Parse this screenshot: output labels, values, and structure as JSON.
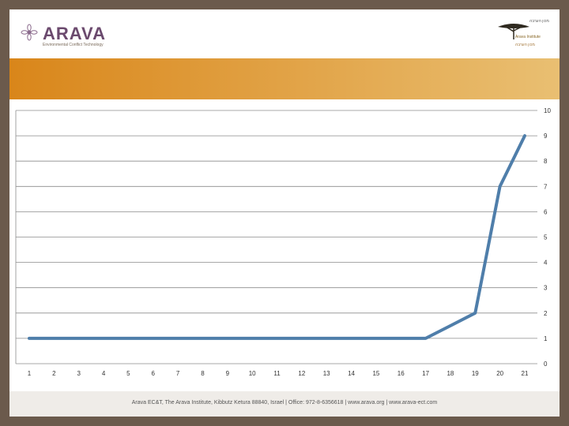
{
  "header": {
    "brand": "ARAVA",
    "tagline": "Environmental Conflict Technology",
    "right_line1": "מכון הערבה",
    "right_line2": "Arava Institute",
    "right_line3": "מכון הערבה"
  },
  "banner": {
    "title": ""
  },
  "footer": {
    "text": "Arava EC&T, The Arava Institute, Kibbutz Ketura 88840, Israel  |  Office: 972-8-6356618  |  www.arava.org  |  www.arava-ect.com"
  },
  "colors": {
    "background": "#6b5a4c",
    "banner_start": "#d9861a",
    "banner_end": "#e9bf72",
    "line": "#4f7eaa",
    "brand": "#6b4a6e"
  },
  "icons": {
    "brand_logo": "flower-icon",
    "institute_logo": "acacia-tree-icon"
  },
  "chart_data": {
    "type": "line",
    "title": "",
    "xlabel": "",
    "ylabel": "",
    "x": [
      1,
      2,
      3,
      4,
      5,
      6,
      7,
      8,
      9,
      10,
      11,
      12,
      13,
      14,
      15,
      16,
      17,
      18,
      19,
      20,
      21
    ],
    "series": [
      {
        "values": [
          1,
          1,
          1,
          1,
          1,
          1,
          1,
          1,
          1,
          1,
          1,
          1,
          1,
          1,
          1,
          1,
          1,
          1.5,
          2,
          7,
          9
        ]
      }
    ],
    "ylim": [
      0,
      10
    ],
    "yticks": [
      0,
      1,
      2,
      3,
      4,
      5,
      6,
      7,
      8,
      9,
      10
    ],
    "y_axis_position": "right",
    "grid": true,
    "legend": "none"
  }
}
